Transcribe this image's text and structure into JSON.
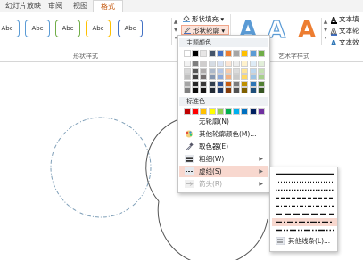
{
  "tabs": [
    {
      "label": "幻灯片放映",
      "active": false
    },
    {
      "label": "审阅",
      "active": false
    },
    {
      "label": "视图",
      "active": false
    },
    {
      "label": "格式",
      "active": true
    }
  ],
  "ribbon": {
    "shape_styles": {
      "samples": [
        "Abc",
        "Abc",
        "Abc",
        "Abc",
        "Abc"
      ],
      "sample_colors": [
        "#5b9bd5",
        "#5b9bd5",
        "#70ad47",
        "#ffc000",
        "#4472c4"
      ],
      "group_label": "形状样式"
    },
    "fill_label": "形状填充",
    "outline_label": "形状轮廓",
    "wordart": {
      "letters": [
        "A",
        "A",
        "A"
      ],
      "letter_colors": [
        "#5b9bd5",
        "#5b9bd5",
        "#ed7d31"
      ],
      "group_label": "艺术字样式"
    },
    "text_fill_label": "文本填",
    "text_outline_label": "文本轮",
    "text_effects_label": "文本效"
  },
  "menu": {
    "theme_colors_label": "主题颜色",
    "theme_colors": [
      [
        "#ffffff",
        "#000000",
        "#e7e6e6",
        "#44546a",
        "#4472c4",
        "#ed7d31",
        "#a5a5a5",
        "#ffc000",
        "#5b9bd5",
        "#70ad47"
      ],
      [
        "#f2f2f2",
        "#7f7f7f",
        "#d0cece",
        "#d6dce4",
        "#d9e2f3",
        "#fbe5d5",
        "#ededed",
        "#fff2cc",
        "#deebf6",
        "#e2efd9"
      ],
      [
        "#d8d8d8",
        "#595959",
        "#aeabab",
        "#adb9ca",
        "#b4c6e7",
        "#f7cbac",
        "#dbdbdb",
        "#fee599",
        "#bdd7ee",
        "#c5e0b3"
      ],
      [
        "#bfbfbf",
        "#3f3f3f",
        "#757070",
        "#8496b0",
        "#8eaadb",
        "#f4b183",
        "#c9c9c9",
        "#ffd965",
        "#9cc3e5",
        "#a8d08d"
      ],
      [
        "#a5a5a5",
        "#262626",
        "#3a3838",
        "#323f4f",
        "#2f5496",
        "#c55a11",
        "#7b7b7b",
        "#bf9000",
        "#2e75b5",
        "#538135"
      ],
      [
        "#7f7f7f",
        "#0c0c0c",
        "#171616",
        "#222a35",
        "#1f3864",
        "#833c0b",
        "#525252",
        "#7f6000",
        "#1e4e79",
        "#375623"
      ]
    ],
    "standard_colors_label": "标准色",
    "standard_colors": [
      "#c00000",
      "#ff0000",
      "#ffc000",
      "#ffff00",
      "#92d050",
      "#00b050",
      "#00b0f0",
      "#0070c0",
      "#002060",
      "#7030a0"
    ],
    "items": [
      {
        "label": "无轮廓(N)",
        "icon": "no-outline-icon",
        "submenu": false,
        "highlighted": false,
        "disabled": false
      },
      {
        "label": "其他轮廓颜色(M)...",
        "icon": "color-palette-icon",
        "submenu": false,
        "highlighted": false,
        "disabled": false
      },
      {
        "label": "取色器(E)",
        "icon": "eyedropper-icon",
        "submenu": false,
        "highlighted": false,
        "disabled": false
      },
      {
        "label": "粗细(W)",
        "icon": "line-weight-icon",
        "submenu": true,
        "highlighted": false,
        "disabled": false
      },
      {
        "label": "虚线(S)",
        "icon": "dash-line-icon",
        "submenu": true,
        "highlighted": true,
        "disabled": false
      },
      {
        "label": "箭头(R)",
        "icon": "arrow-icon",
        "submenu": true,
        "highlighted": false,
        "disabled": true
      }
    ]
  },
  "submenu": {
    "dash_styles": [
      "solid",
      "round-dot",
      "square-dot",
      "dash",
      "dash-dot",
      "long-dash",
      "long-dash-dot",
      "long-dash-dot-dot"
    ],
    "selected_index": 6,
    "more_label": "其他线条(L)..."
  }
}
